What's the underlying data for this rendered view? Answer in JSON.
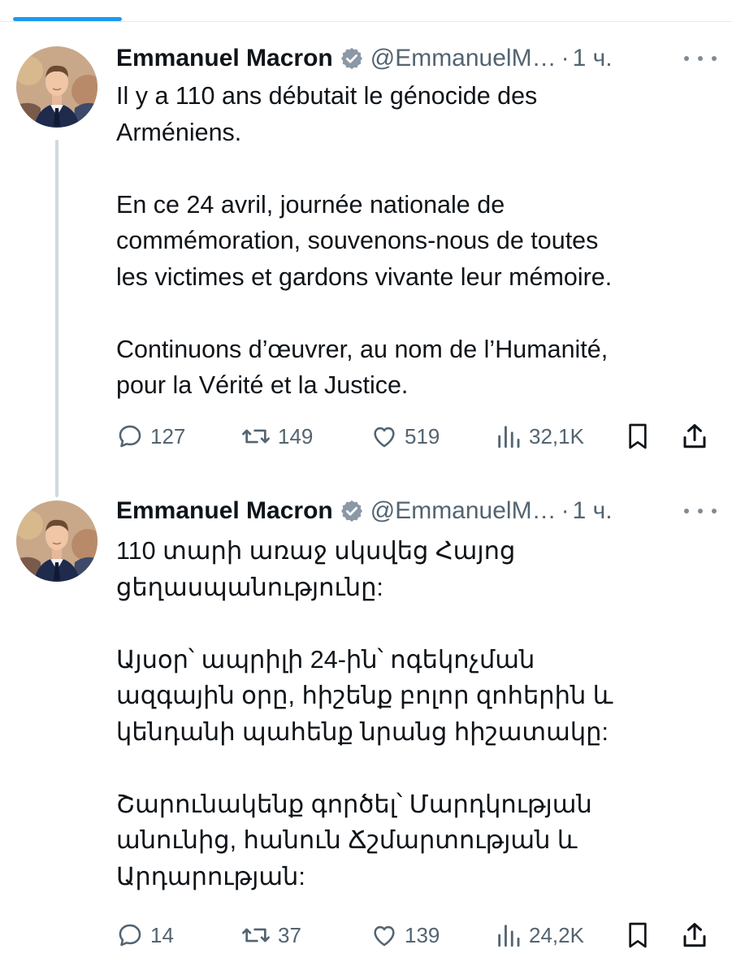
{
  "colors": {
    "text": "#0f1419",
    "muted": "#536471",
    "verified": "#8b98a5",
    "accent": "#1d9bf0",
    "thread_line": "#cfd9de"
  },
  "tweets": [
    {
      "author": {
        "name": "Emmanuel Macron",
        "handle": "@EmmanuelM…",
        "verified_icon": "verified-badge-icon"
      },
      "separator": "·",
      "time": "1 ч.",
      "more_icon": "more-options-icon",
      "paragraphs": [
        [
          "Il y a 110 ans débutait le génocide des",
          "Arméniens."
        ],
        [
          "En ce 24 avril, journée nationale de",
          "commémoration, souvenons-nous de toutes",
          "les victimes et gardons vivante leur mémoire."
        ],
        [
          "Continuons d’œuvrer, au nom de l’Humanité,",
          "pour la Vérité et la Justice."
        ]
      ],
      "actions": {
        "replies": "127",
        "reposts": "149",
        "likes": "519",
        "views": "32,1K"
      }
    },
    {
      "author": {
        "name": "Emmanuel Macron",
        "handle": "@EmmanuelM…",
        "verified_icon": "verified-badge-icon"
      },
      "separator": "·",
      "time": "1 ч.",
      "more_icon": "more-options-icon",
      "paragraphs": [
        [
          "110 տարի առաջ սկսվեց Հայոց",
          "ցեղասպանությունը:"
        ],
        [
          "Այսօր՝ ապրիլի 24-ին՝ ոգեկոչման",
          "ազգային օրը, հիշենք բոլոր զոհերին և",
          "կենդանի պահենք նրանց հիշատակը:"
        ],
        [
          "Շարունակենք գործել՝ Մարդկության",
          "անունից, հանուն Ճշմարտության և",
          "Արդարության:"
        ]
      ],
      "actions": {
        "replies": "14",
        "reposts": "37",
        "likes": "139",
        "views": "24,2K"
      }
    }
  ]
}
